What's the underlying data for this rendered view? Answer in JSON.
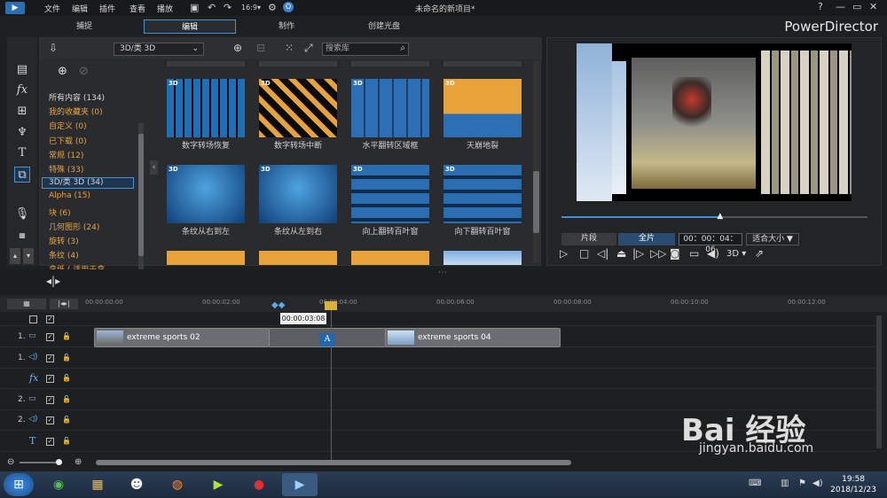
{
  "menu": {
    "items": [
      "文件",
      "编辑",
      "插件",
      "查看",
      "播放"
    ]
  },
  "window": {
    "title": "未命名的新项目*",
    "help": "?",
    "minimize": "—",
    "maximize": "▭",
    "close": "✕"
  },
  "modes": {
    "items": [
      "捕捉",
      "编辑",
      "制作",
      "创建光盘"
    ],
    "active": "编辑"
  },
  "brand": "PowerDirector",
  "library": {
    "combo": "3D/类 3D",
    "search_placeholder": "搜索库",
    "categories": [
      {
        "label": "所有内容 (134)",
        "color": "#d8d8d8"
      },
      {
        "label": "我的收藏夹 (0)",
        "color": "#e5a445"
      },
      {
        "label": "自定义 (0)",
        "color": "#e5a445"
      },
      {
        "label": "已下载 (0)",
        "color": "#e5a445"
      },
      {
        "label": "常规 (12)",
        "color": "#e5a445"
      },
      {
        "label": "特殊 (33)",
        "color": "#e5a445"
      },
      {
        "label": "3D/类 3D (34)",
        "color": "#d8d8d8"
      },
      {
        "label": "Alpha (15)",
        "color": "#e5a445"
      },
      {
        "label": "块 (6)",
        "color": "#e5a445"
      },
      {
        "label": "几何图形 (24)",
        "color": "#e5a445"
      },
      {
        "label": "旋转 (3)",
        "color": "#e5a445"
      },
      {
        "label": "条纹 (4)",
        "color": "#e5a445"
      },
      {
        "label": "拿纸 ( 适用于拿",
        "color": "#e5a445"
      }
    ],
    "selected_index": 6,
    "transitions": [
      {
        "tag": "3D",
        "label": "数字转场恢复",
        "style": "blocks-blue"
      },
      {
        "tag": "3D",
        "label": "数字转场中断",
        "style": "blocks-orange"
      },
      {
        "tag": "3D",
        "label": "水平翻转区域框",
        "style": "tiles-a"
      },
      {
        "tag": "3D",
        "label": "天崩地裂",
        "style": "orange-b"
      },
      {
        "tag": "3D",
        "label": "条纹从右到左",
        "style": "blue-a"
      },
      {
        "tag": "3D",
        "label": "条纹从左到右",
        "style": "blue-a"
      },
      {
        "tag": "3D",
        "label": "向上翻转百叶窗",
        "style": "blinds-a"
      },
      {
        "tag": "3D",
        "label": "向下翻转百叶窗",
        "style": "blinds-a"
      }
    ]
  },
  "preview": {
    "progress": 0.52,
    "btn_clip": "片段",
    "btn_full": "全片",
    "timecode": "00：00：04：06",
    "fit": "适合大小 ▼",
    "mode3d": "3D ▾"
  },
  "timeline": {
    "timecodes": [
      "00:00:00:00",
      "00:00:02:00",
      "00:00:04:00",
      "00:00:06:00",
      "00:00:08:00",
      "00:00:10:00",
      "00:00:12:00"
    ],
    "playhead_label": "00:00:03:08",
    "tracks": [
      {
        "name": "1.",
        "kind": "video"
      },
      {
        "name": "1.",
        "kind": "audio"
      },
      {
        "name": "fx",
        "kind": "fx"
      },
      {
        "name": "2.",
        "kind": "video"
      },
      {
        "name": "2.",
        "kind": "audio"
      },
      {
        "name": "T",
        "kind": "title"
      }
    ],
    "clips": [
      {
        "label": "extreme sports 02"
      },
      {
        "label": "A"
      },
      {
        "label": "extreme sports 04"
      }
    ]
  },
  "taskbar": {
    "time": "19:58",
    "date": "2018/12/23"
  },
  "watermark": {
    "text": "Bai 经验",
    "url": "jingyan.baidu.com"
  },
  "colors": {
    "accent": "#4a8fd0",
    "category": "#e5a445",
    "playhead": "#d23030"
  }
}
